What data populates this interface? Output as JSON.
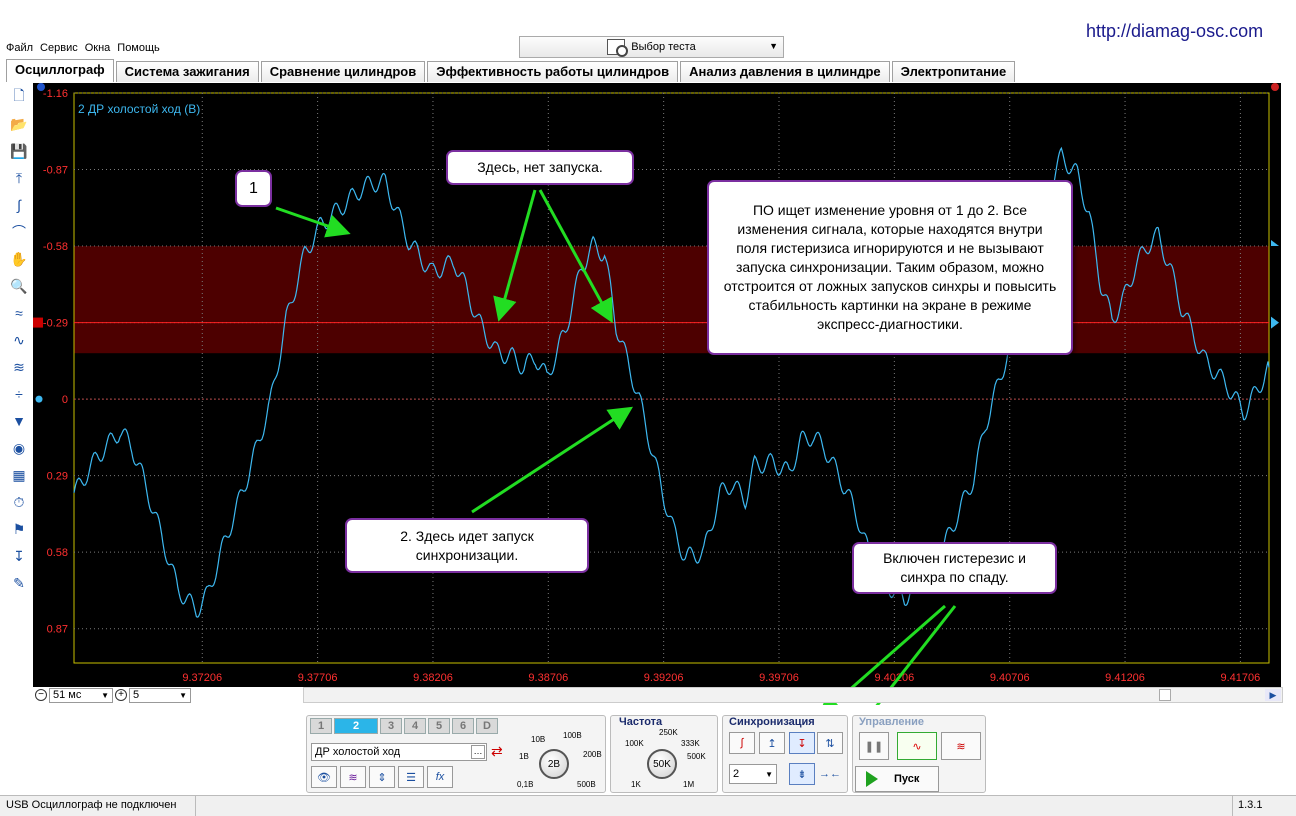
{
  "site_url": "http://diamag-osc.com",
  "menu": [
    "Файл",
    "Сервис",
    "Окна",
    "Помощь"
  ],
  "test_selector": {
    "label": "Выбор теста"
  },
  "tabs": [
    {
      "label": "Осциллограф",
      "active": true
    },
    {
      "label": "Система зажигания",
      "active": false
    },
    {
      "label": "Сравнение цилиндров",
      "active": false
    },
    {
      "label": "Эффективность работы цилиндров",
      "active": false
    },
    {
      "label": "Анализ давления в цилиндре",
      "active": false
    },
    {
      "label": "Электропитание",
      "active": false
    }
  ],
  "toolbar_icons": [
    "new-file-icon",
    "open-folder-icon",
    "save-icon",
    "auto-trigger-icon",
    "auto-scale-icon",
    "waveform-arc-icon",
    "hand-pan-icon",
    "zoom-icon",
    "waves-1-icon",
    "waves-2-icon",
    "waves-3-icon",
    "split-icon",
    "filter-icon",
    "channel-icon",
    "table-icon",
    "auto-timer-icon",
    "flag-icon",
    "marker-zero-icon",
    "notes-icon"
  ],
  "channel_label": "2 ДР холостой ход (В)",
  "colors": {
    "trace": "#3db8f0",
    "grid": "#7a7a7a",
    "hysteresis_band": "#5a0000",
    "trigger_line": "#ff2020",
    "axis_text": "#ff3030",
    "callout_border": "#7b2fa0",
    "arrow": "#22dd22"
  },
  "chart_data": {
    "type": "line",
    "y_ticks": [
      "-1.16",
      "-0.87",
      "-0.58",
      "-0.29",
      "0",
      "0.29",
      "0.58",
      "0.87"
    ],
    "x_ticks": [
      "9.37206",
      "9.37706",
      "9.38206",
      "9.38706",
      "9.39206",
      "9.39706",
      "9.40206",
      "9.40706",
      "9.41206",
      "9.41706"
    ],
    "x_range": [
      9.3665,
      9.4183
    ],
    "y_range_top_to_bottom": [
      -1.16,
      1.0
    ],
    "y_axis_inverted": true,
    "grid": true,
    "hysteresis_band": [
      -0.29,
      -0.58
    ],
    "trigger_level": -0.29,
    "series": [
      {
        "x": [
          9.3665,
          9.3675,
          9.3685,
          9.369,
          9.3695,
          9.3703,
          9.371,
          9.3718,
          9.3723,
          9.373,
          9.374,
          9.375,
          9.3757,
          9.3765,
          9.3772,
          9.378,
          9.379,
          9.3795,
          9.38,
          9.381,
          9.382,
          9.383,
          9.3835,
          9.384,
          9.3848,
          9.3855,
          9.386,
          9.3865,
          9.387,
          9.3878,
          9.3885,
          9.389,
          9.3895,
          9.39,
          9.391,
          9.392,
          9.3925,
          9.393,
          9.3938,
          9.3945,
          9.395,
          9.3956,
          9.396,
          9.3968,
          9.3975,
          9.398,
          9.3985,
          9.399,
          9.4,
          9.4006,
          9.401,
          9.4017,
          9.4025,
          9.403,
          9.404,
          9.4048,
          9.4055,
          9.406,
          9.407,
          9.4075,
          9.408,
          9.4087,
          9.4093,
          9.41,
          9.4105,
          9.411,
          9.4115,
          9.412,
          9.4125,
          9.413,
          9.4135,
          9.414,
          9.4145,
          9.4155,
          9.4165,
          9.4172,
          9.4177,
          9.4183
        ],
        "y": [
          0.36,
          0.22,
          0.12,
          0.18,
          0.3,
          0.52,
          0.72,
          0.8,
          0.74,
          0.55,
          0.3,
          0.02,
          -0.3,
          -0.55,
          -0.66,
          -0.72,
          -0.8,
          -0.82,
          -0.82,
          -0.6,
          -0.48,
          -0.52,
          -0.42,
          -0.3,
          -0.18,
          -0.16,
          -0.12,
          -0.16,
          -0.08,
          -0.26,
          -0.5,
          -0.58,
          -0.55,
          -0.28,
          0.0,
          0.35,
          0.5,
          0.6,
          0.58,
          0.36,
          0.32,
          0.38,
          0.25,
          0.24,
          0.28,
          0.16,
          0.14,
          0.18,
          0.35,
          0.48,
          0.6,
          0.7,
          0.76,
          0.68,
          0.6,
          0.44,
          0.3,
          0.1,
          -0.18,
          -0.38,
          -0.55,
          -0.78,
          -0.92,
          -0.85,
          -0.7,
          -0.44,
          -0.3,
          -0.38,
          -0.5,
          -0.58,
          -0.62,
          -0.5,
          -0.35,
          -0.15,
          -0.05,
          0.05,
          -0.02,
          -0.12
        ]
      }
    ]
  },
  "annotations": {
    "marker_1": "1",
    "no_trigger": "Здесь, нет запуска.",
    "explanation": "ПО ищет изменение уровня от 1 до 2. Все изменения сигнала, которые находятся внутри поля гистеризиса игнорируются и не вызывают запуска синхронизации. Таким образом, можно отстроится от ложных запусков синхры и повысить стабильность картинки на экране в режиме экспресс-диагностики.",
    "trigger_here": "2. Здесь идет запуск синхронизации.",
    "hysteresis_on": "Включен гистерезис и синхра по спаду."
  },
  "timebar": {
    "timebase": "51 мс",
    "count": "5"
  },
  "channels_panel": {
    "buttons": [
      "1",
      "2",
      "3",
      "4",
      "5",
      "6",
      "D"
    ],
    "active": "2",
    "channel_name": "ДР холостой ход",
    "knob_value": "2В",
    "knob_labels": [
      "10В",
      "100В",
      "1В",
      "200В",
      "0,1В",
      "500В"
    ]
  },
  "frequency_panel": {
    "title": "Частота",
    "knob_value": "50K",
    "knob_labels": [
      "250K",
      "100K",
      "333K",
      "500K",
      "1K",
      "1M"
    ]
  },
  "sync_panel": {
    "title": "Синхронизация",
    "channel": "2"
  },
  "control_panel": {
    "title": "Управление",
    "start_label": "Пуск"
  },
  "status": {
    "left": "USB Осциллограф не подключен",
    "version": "1.3.1"
  }
}
